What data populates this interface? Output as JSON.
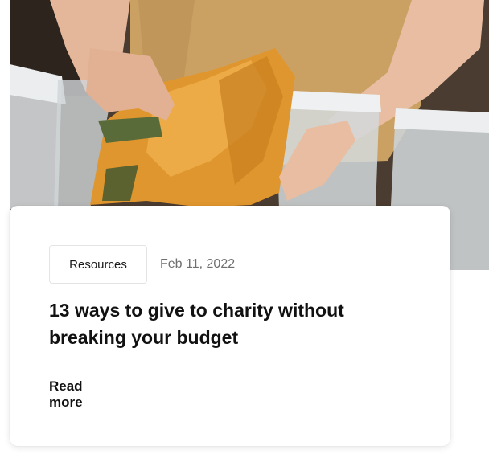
{
  "hero": {
    "image_subject": "hands-folding-mustard-jacket-over-plastic-bins"
  },
  "card": {
    "category": "Resources",
    "date": "Feb 11, 2022",
    "title": "13 ways to give to charity without breaking your budget",
    "read_more": "Read more"
  },
  "colors": {
    "card_background": "#ffffff",
    "title_text": "#111111",
    "date_text": "#6f6f6f",
    "chip_border": "#e4e4e4",
    "jacket": "#e0962e",
    "shirt": "#caa163"
  }
}
